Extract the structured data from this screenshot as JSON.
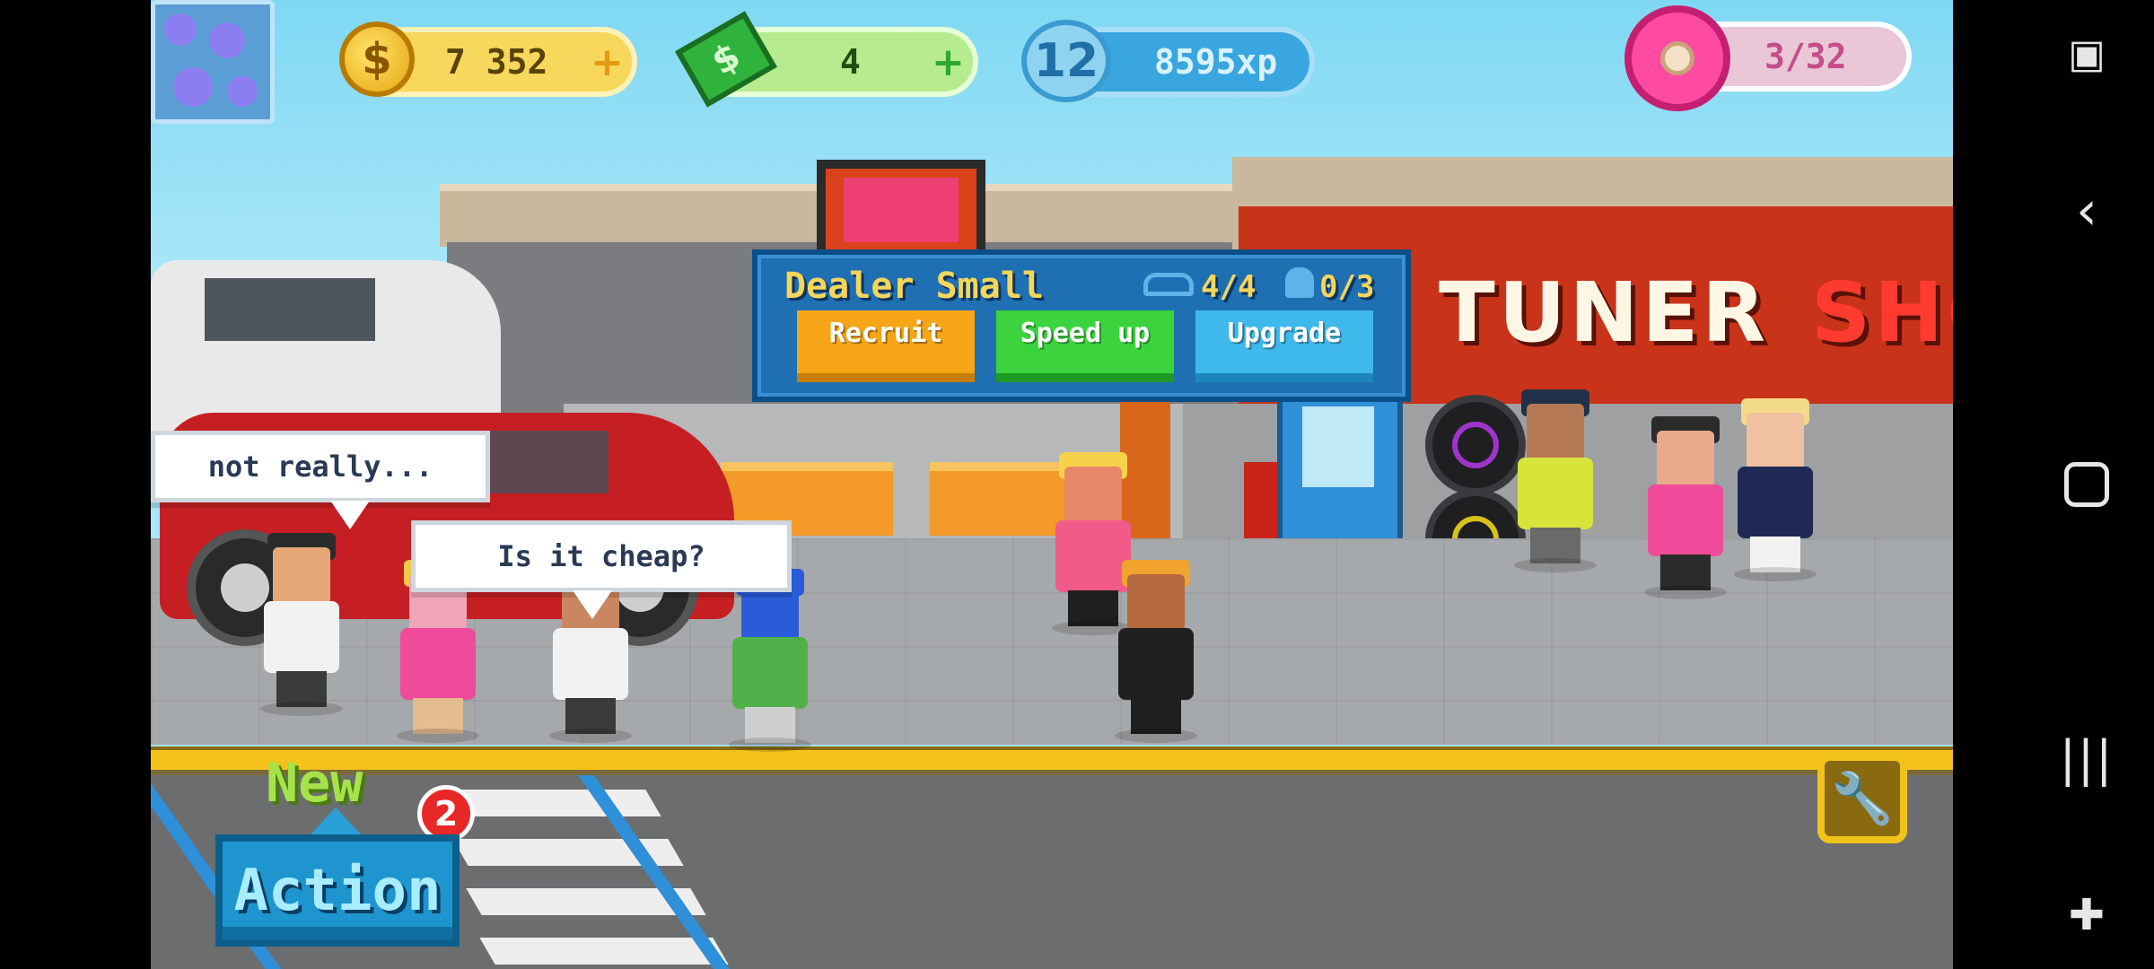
{
  "hud": {
    "coins": "7 352",
    "cash": "4",
    "level": "12",
    "xp": "8595xp",
    "donuts": "3/32",
    "plus": "+",
    "coin_symbol": "$",
    "cash_symbol": "$"
  },
  "panel": {
    "title": "Dealer Small",
    "cars": "4/4",
    "staff": "0/3",
    "buttons": [
      {
        "label": "Recruit",
        "color": "#f5a516"
      },
      {
        "label": "Speed up",
        "color": "#3bd43f"
      },
      {
        "label": "Upgrade",
        "color": "#3fb8ec"
      }
    ]
  },
  "shop_sign": {
    "word1": "TUNER",
    "word2": "SHO"
  },
  "bubbles": {
    "left": "not really...",
    "right": "Is it cheap?"
  },
  "bottom": {
    "new_label": "New",
    "badge_count": "2",
    "action_label": "Action"
  },
  "icons": {
    "wrench": "wrench-icon",
    "back": "back-icon",
    "home": "home-icon",
    "recents": "recents-icon",
    "gamepad": "gamepad-icon",
    "screenshot": "screenshot-icon"
  }
}
